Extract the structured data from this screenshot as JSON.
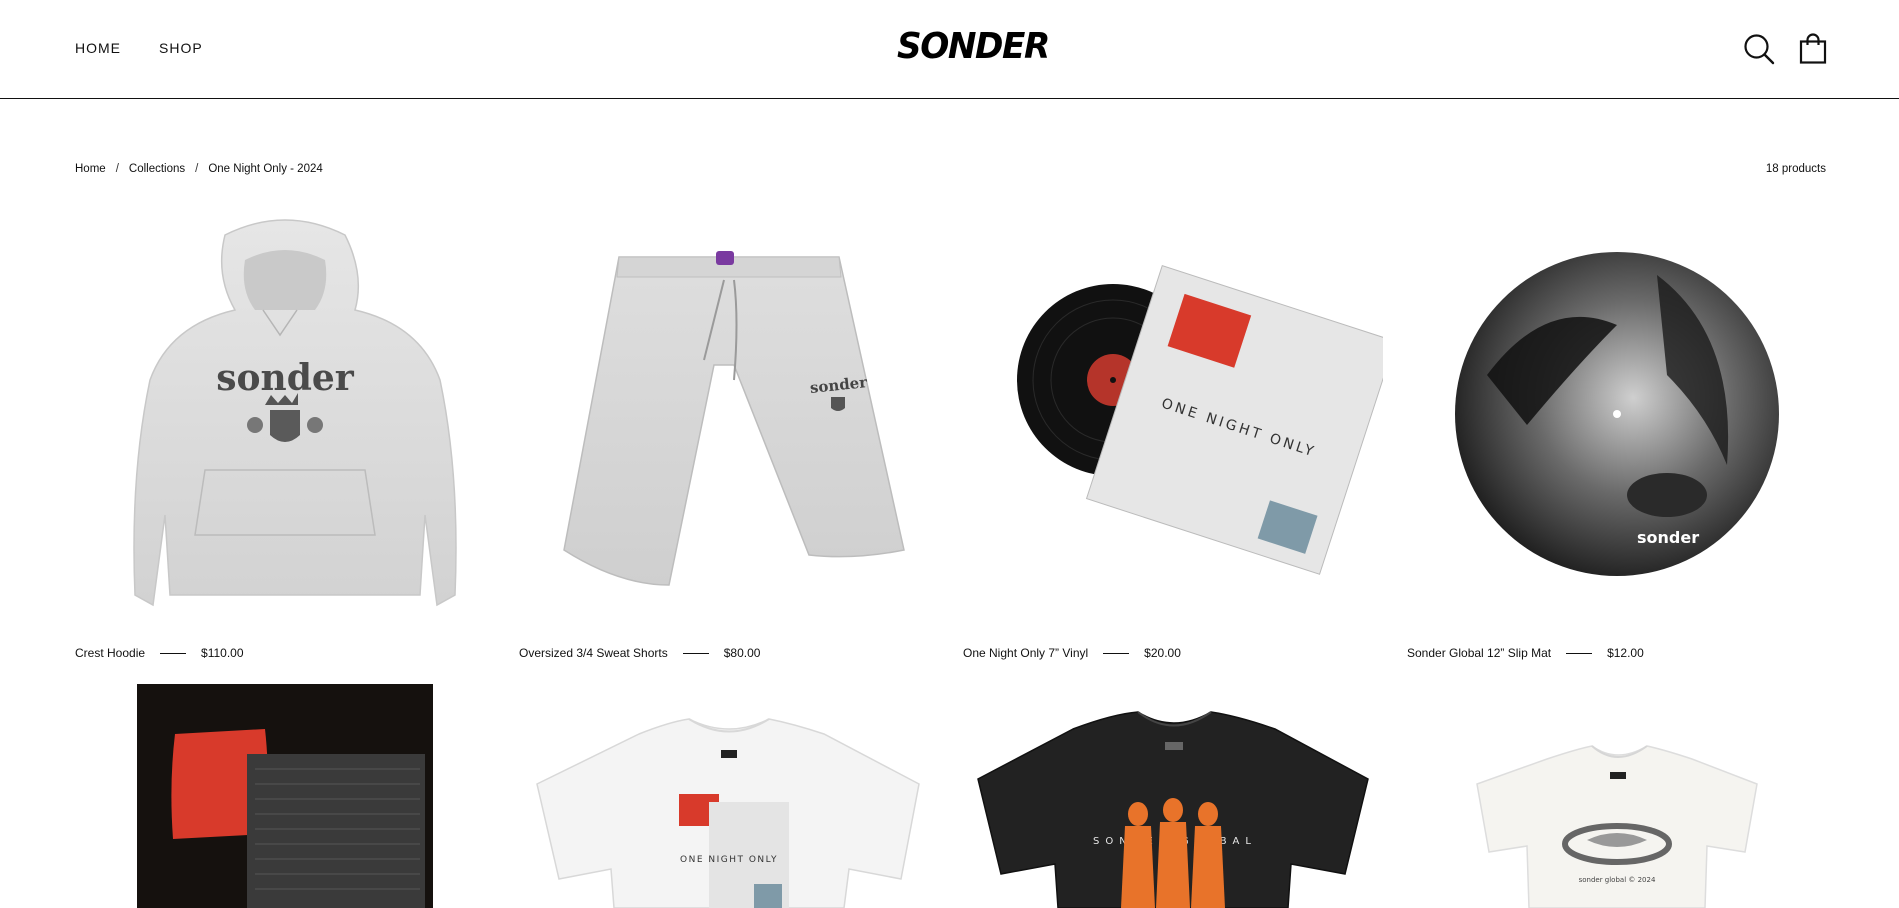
{
  "header": {
    "nav": [
      {
        "label": "HOME"
      },
      {
        "label": "SHOP"
      }
    ],
    "logo": "SONDER"
  },
  "breadcrumb": {
    "items": [
      "Home",
      "Collections",
      "One Night Only - 2024"
    ],
    "separator": "/"
  },
  "product_count": "18 products",
  "products": [
    {
      "name": "Crest Hoodie",
      "price": "$110.00"
    },
    {
      "name": "Oversized 3/4 Sweat Shorts",
      "price": "$80.00"
    },
    {
      "name": "One Night Only 7” Vinyl",
      "price": "$20.00"
    },
    {
      "name": "Sonder Global 12” Slip Mat",
      "price": "$12.00"
    }
  ],
  "product_art": {
    "hoodie_print": "sonder",
    "shorts_print": "sonder",
    "vinyl_sleeve_text": "ONE NIGHT ONLY",
    "slipmat_label": "sonder",
    "tee_white_text": "ONE NIGHT ONLY",
    "tee_black_text": "SONDER GLOBAL",
    "baby_tee_text": "sonder global © 2024"
  },
  "colors": {
    "text": "#111111",
    "accent_red": "#d83a2b",
    "heather_grey": "#dcdcdc"
  }
}
